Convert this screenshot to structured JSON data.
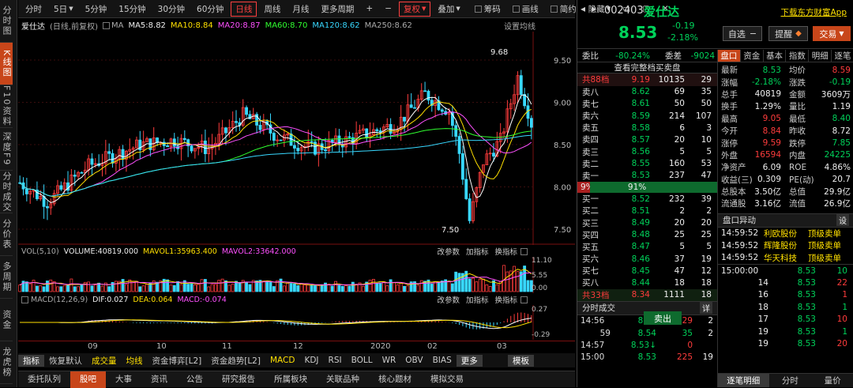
{
  "left_tabs": [
    "分时图",
    "K线图",
    "F10资料",
    "深度F9",
    "分时成交",
    "分价表",
    "多周期",
    "资金",
    "龙虎榜"
  ],
  "toolbar": {
    "periods": [
      "分时",
      "5日",
      "5分钟",
      "15分钟",
      "30分钟",
      "60分钟",
      "日线",
      "周线",
      "月线",
      "更多周期"
    ],
    "active_period": "日线",
    "zoom_in": "+",
    "zoom_out": "−",
    "tools": [
      "复权",
      "叠加",
      "筹码",
      "画线",
      "简约",
      "隐藏"
    ],
    "window_icons": [
      "▭",
      "▢",
      "✕"
    ]
  },
  "chart_info": {
    "name": "爱仕达",
    "mode": "(日线,前复权)",
    "ma_label": "MA",
    "ma5": "MA5:8.82",
    "ma10": "MA10:8.84",
    "ma20": "MA20:8.87",
    "ma60": "MA60:8.70",
    "ma120": "MA120:8.62",
    "ma250": "MA250:8.62",
    "settings": "设置均线"
  },
  "price_axis": [
    "9.50",
    "9.00",
    "8.50",
    "8.00",
    "7.50"
  ],
  "annotations": {
    "high": "9.68",
    "low": "7.50"
  },
  "volume_bar": {
    "label": "VOL(5,10)",
    "vol": "VOLUME:40819.000",
    "mavol1": "MAVOL1:35963.400",
    "mavol2": "MAVOL2:33642.000",
    "buttons": [
      "改参数",
      "加指标",
      "换指标"
    ],
    "axis": [
      "11.10",
      "5.55",
      "0.00"
    ]
  },
  "macd_bar": {
    "label": "MACD(12,26,9)",
    "dif": "DIF:0.027",
    "dea": "DEA:0.064",
    "macd": "MACD:-0.074",
    "buttons": [
      "改参数",
      "加指标",
      "换指标"
    ],
    "axis": [
      "0.27",
      "-0.29"
    ]
  },
  "dates": [
    "09",
    "10",
    "11",
    "12",
    "2020",
    "02",
    "03"
  ],
  "indicator_tabs": [
    "指标",
    "恢复默认",
    "成交量",
    "均线",
    "资金博弈[L2]",
    "资金趋势[L2]",
    "MACD",
    "KDJ",
    "RSI",
    "BOLL",
    "WR",
    "OBV",
    "BIAS",
    "更多",
    "模板"
  ],
  "bottom_tabs": [
    "委托队列",
    "股吧",
    "大事",
    "资讯",
    "公告",
    "研究报告",
    "所属板块",
    "关联品种",
    "核心题材",
    "模拟交易"
  ],
  "active_bottom": "股吧",
  "stock": {
    "code": "002403",
    "name": "爱仕达",
    "price": "8.53",
    "change": "-0.19",
    "pct": "-2.18%",
    "app_link": "下载东方财富App",
    "watch_btn": "自选",
    "alert_btn": "提醒",
    "trade_btn": "交易"
  },
  "order_book": {
    "weibi_label": "委比",
    "weibi": "-80.24%",
    "weicha_label": "委差",
    "weicha": "-9024",
    "full_book": "查看完整档买卖盘",
    "ask_total": {
      "label": "共88档",
      "price": "9.19",
      "vol": "10135",
      "count": "29"
    },
    "asks": [
      {
        "label": "卖八",
        "price": "8.62",
        "vol": "69",
        "count": "35"
      },
      {
        "label": "卖七",
        "price": "8.61",
        "vol": "50",
        "count": "50"
      },
      {
        "label": "卖六",
        "price": "8.59",
        "vol": "214",
        "count": "107"
      },
      {
        "label": "卖五",
        "price": "8.58",
        "vol": "6",
        "count": "3"
      },
      {
        "label": "卖四",
        "price": "8.57",
        "vol": "20",
        "count": "10"
      },
      {
        "label": "卖三",
        "price": "8.56",
        "vol": "5",
        "count": "5"
      },
      {
        "label": "卖二",
        "price": "8.55",
        "vol": "160",
        "count": "53"
      },
      {
        "label": "卖一",
        "price": "8.53",
        "vol": "237",
        "count": "47"
      }
    ],
    "ratio_left": "9%",
    "ratio_right": "91%",
    "ratio_left_value": 0.09,
    "bids": [
      {
        "label": "买一",
        "price": "8.52",
        "vol": "232",
        "count": "39"
      },
      {
        "label": "买二",
        "price": "8.51",
        "vol": "2",
        "count": "2"
      },
      {
        "label": "买三",
        "price": "8.49",
        "vol": "20",
        "count": "20"
      },
      {
        "label": "买四",
        "price": "8.48",
        "vol": "25",
        "count": "25"
      },
      {
        "label": "买五",
        "price": "8.47",
        "vol": "5",
        "count": "5"
      },
      {
        "label": "买六",
        "price": "8.46",
        "vol": "37",
        "count": "19"
      },
      {
        "label": "买七",
        "price": "8.45",
        "vol": "47",
        "count": "12"
      },
      {
        "label": "买八",
        "price": "8.44",
        "vol": "18",
        "count": "18"
      }
    ],
    "sell_btn": "卖出",
    "bid_total": {
      "label": "共33档",
      "price": "8.34",
      "vol": "1111",
      "count": "18"
    }
  },
  "ticks": {
    "title": "分时成交",
    "detail": "详",
    "rows": [
      {
        "time": "14:56",
        "price": "8.54",
        "vol": "29",
        "n": "2"
      },
      {
        "time": "59",
        "price": "8.54",
        "vol": "35",
        "n": "2"
      },
      {
        "time": "14:57",
        "price": "8.53↓",
        "vol": "0",
        "n": ""
      },
      {
        "time": "15:00",
        "price": "8.53",
        "vol": "225",
        "n": "19"
      }
    ]
  },
  "info_tabs": [
    "盘口",
    "资金",
    "基本",
    "指数",
    "明细",
    "逐笔"
  ],
  "info_rows": [
    {
      "l1": "最新",
      "v1": "8.53",
      "l2": "均价",
      "v2": "8.59"
    },
    {
      "l1": "涨幅",
      "v1": "-2.18%",
      "l2": "涨跌",
      "v2": "-0.19"
    },
    {
      "l1": "总手",
      "v1": "40819",
      "l2": "金额",
      "v2": "3609万"
    },
    {
      "l1": "换手",
      "v1": "1.29%",
      "l2": "量比",
      "v2": "1.19"
    },
    {
      "l1": "最高",
      "v1": "9.05",
      "l2": "最低",
      "v2": "8.40"
    },
    {
      "l1": "今开",
      "v1": "8.84",
      "l2": "昨收",
      "v2": "8.72"
    },
    {
      "l1": "涨停",
      "v1": "9.59",
      "l2": "跌停",
      "v2": "7.85"
    },
    {
      "l1": "外盘",
      "v1": "16594",
      "l2": "内盘",
      "v2": "24225"
    },
    {
      "l1": "净资产",
      "v1": "6.09",
      "l2": "ROE",
      "v2": "4.86%"
    },
    {
      "l1": "收益(三)",
      "v1": "0.309",
      "l2": "PE(动)",
      "v2": "20.7"
    },
    {
      "l1": "总股本",
      "v1": "3.50亿",
      "l2": "总值",
      "v2": "29.9亿"
    },
    {
      "l1": "流通股",
      "v1": "3.16亿",
      "l2": "流值",
      "v2": "26.9亿"
    }
  ],
  "panic": {
    "title": "盘口异动",
    "settings": "设",
    "rows": [
      {
        "time": "14:59:52",
        "name": "利欧股份",
        "event": "顶级卖单"
      },
      {
        "time": "14:59:52",
        "name": "辉隆股份",
        "event": "顶级卖单"
      },
      {
        "time": "14:59:52",
        "name": "华天科技",
        "event": "顶级卖单"
      }
    ]
  },
  "trades": [
    {
      "time": "15:00:00",
      "price": "8.53",
      "vol": "10"
    },
    {
      "time": "14",
      "price": "8.53",
      "vol": "22"
    },
    {
      "time": "16",
      "price": "8.53",
      "vol": "1"
    },
    {
      "time": "18",
      "price": "8.53",
      "vol": "1"
    },
    {
      "time": "17",
      "price": "8.53",
      "vol": "10"
    },
    {
      "time": "19",
      "price": "8.53",
      "vol": "1"
    },
    {
      "time": "19",
      "price": "8.53",
      "vol": "20"
    }
  ],
  "right_bottom_tabs": [
    "逐笔明细",
    "分时",
    "量价"
  ],
  "colors": {
    "up": "#ff3c3c",
    "down": "#00d25a",
    "accent": "#c8461a",
    "ma5": "#ffffff",
    "ma10": "#ffe000",
    "ma20": "#ff50ff",
    "ma60": "#30ff30",
    "ma120": "#38d8ff",
    "ma250": "#aaaaaa"
  }
}
